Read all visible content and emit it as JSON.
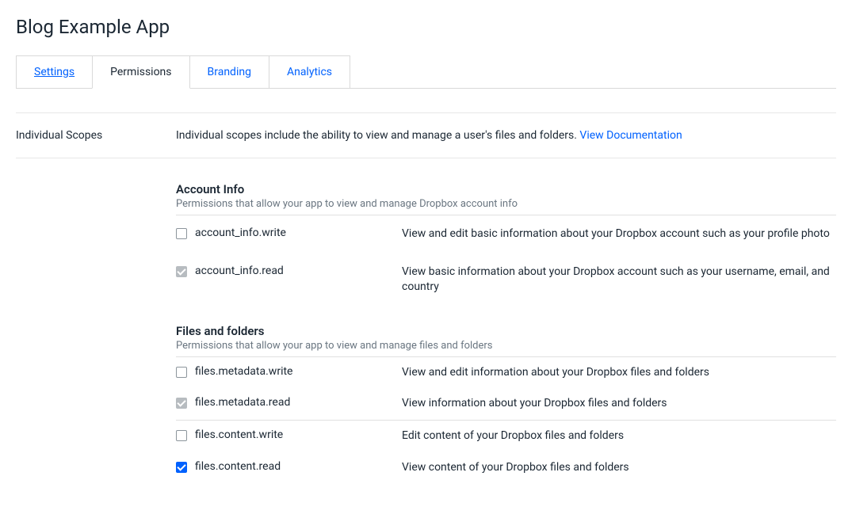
{
  "title": "Blog Example App",
  "tabs": [
    {
      "label": "Settings",
      "active": false,
      "underline": true
    },
    {
      "label": "Permissions",
      "active": true,
      "underline": false
    },
    {
      "label": "Branding",
      "active": false,
      "underline": false
    },
    {
      "label": "Analytics",
      "active": false,
      "underline": false
    }
  ],
  "individual_scopes": {
    "label": "Individual Scopes",
    "description": "Individual scopes include the ability to view and manage a user's files and folders. ",
    "doc_link": "View Documentation"
  },
  "groups": [
    {
      "title": "Account Info",
      "subtitle": "Permissions that allow your app to view and manage Dropbox account info",
      "perms": [
        {
          "name": "account_info.write",
          "desc": "View and edit basic information about your Dropbox account such as your profile photo",
          "state": "unchecked"
        },
        {
          "name": "account_info.read",
          "desc": "View basic information about your Dropbox account such as your username, email, and country",
          "state": "gray"
        }
      ]
    },
    {
      "title": "Files and folders",
      "subtitle": "Permissions that allow your app to view and manage files and folders",
      "perms": [
        {
          "name": "files.metadata.write",
          "desc": "View and edit information about your Dropbox files and folders",
          "state": "unchecked"
        },
        {
          "name": "files.metadata.read",
          "desc": "View information about your Dropbox files and folders",
          "state": "gray",
          "divider": true
        },
        {
          "name": "files.content.write",
          "desc": "Edit content of your Dropbox files and folders",
          "state": "unchecked"
        },
        {
          "name": "files.content.read",
          "desc": "View content of your Dropbox files and folders",
          "state": "blue"
        }
      ]
    }
  ]
}
